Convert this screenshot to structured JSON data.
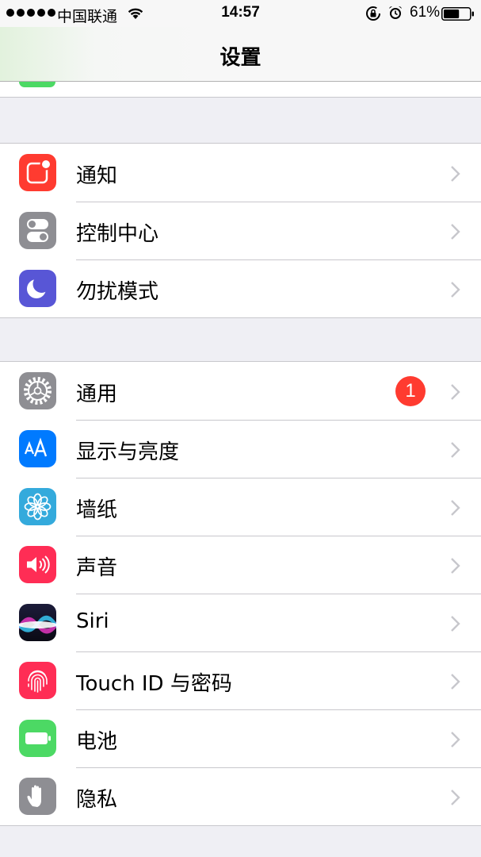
{
  "status_bar": {
    "carrier": "中国联通",
    "time": "14:57",
    "battery_percent": "61%",
    "battery_level": 0.61,
    "signal_bars": 5
  },
  "nav": {
    "title": "设置"
  },
  "groups": [
    {
      "items": [
        {
          "label": "通知",
          "icon": "notifications-icon",
          "color": "#ff3b30"
        },
        {
          "label": "控制中心",
          "icon": "control-center-icon",
          "color": "#8e8e93"
        },
        {
          "label": "勿扰模式",
          "icon": "do-not-disturb-icon",
          "color": "#5856d6"
        }
      ]
    },
    {
      "items": [
        {
          "label": "通用",
          "icon": "general-gear-icon",
          "color": "#8e8e93",
          "badge": "1"
        },
        {
          "label": "显示与亮度",
          "icon": "display-brightness-icon",
          "color": "#007aff"
        },
        {
          "label": "墙纸",
          "icon": "wallpaper-icon",
          "color": "#34aadc"
        },
        {
          "label": "声音",
          "icon": "sounds-icon",
          "color": "#ff2d55"
        },
        {
          "label": "Siri",
          "icon": "siri-icon",
          "color": "#1a1a2e"
        },
        {
          "label": "Touch ID 与密码",
          "icon": "touch-id-icon",
          "color": "#ff2d55"
        },
        {
          "label": "电池",
          "icon": "battery-icon",
          "color": "#4cd964"
        },
        {
          "label": "隐私",
          "icon": "privacy-hand-icon",
          "color": "#8e8e93"
        }
      ]
    }
  ],
  "colors": {
    "background": "#efeff4",
    "separator": "#c8c7cc",
    "chevron": "#c7c7cc",
    "badge": "#ff3b30"
  }
}
